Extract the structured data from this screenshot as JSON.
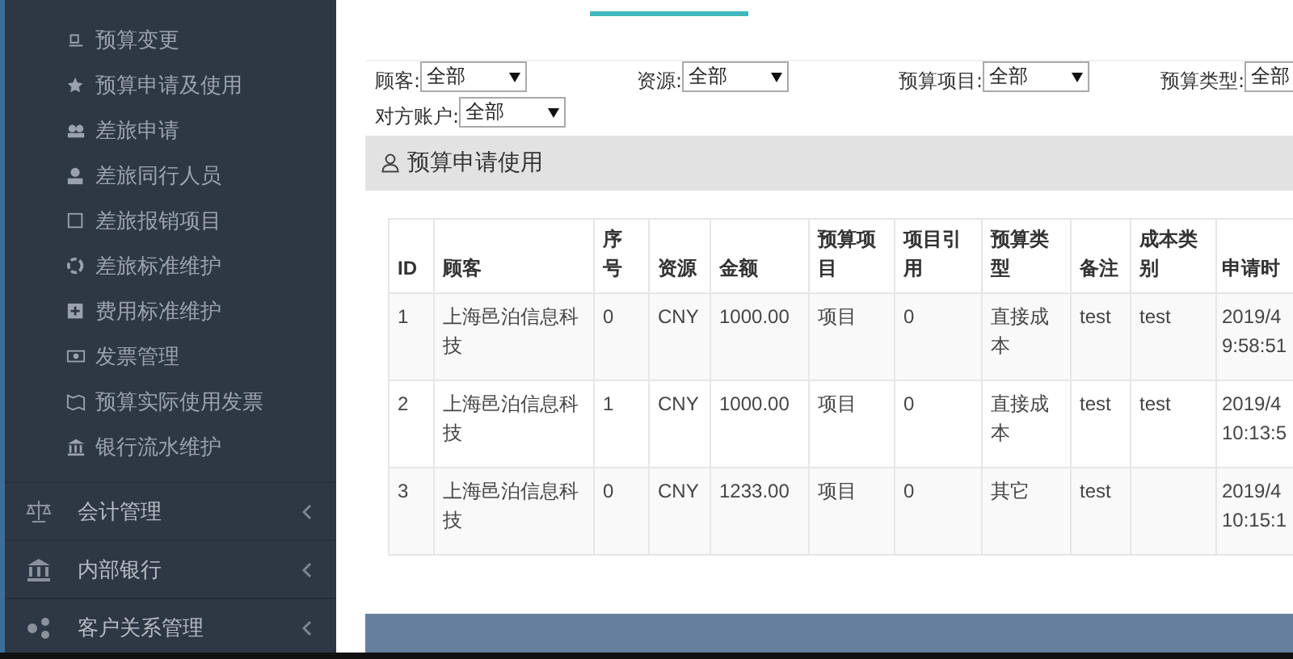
{
  "sidebar": {
    "sub_items": [
      {
        "label": "预算变更"
      },
      {
        "label": "预算申请及使用"
      },
      {
        "label": "差旅申请"
      },
      {
        "label": "差旅同行人员"
      },
      {
        "label": "差旅报销项目"
      },
      {
        "label": "差旅标准维护"
      },
      {
        "label": "费用标准维护"
      },
      {
        "label": "发票管理"
      },
      {
        "label": "预算实际使用发票"
      },
      {
        "label": "银行流水维护"
      }
    ],
    "sections": [
      {
        "label": "会计管理"
      },
      {
        "label": "内部银行"
      },
      {
        "label": "客户关系管理"
      }
    ]
  },
  "filters": [
    {
      "label": "顾客:",
      "value": "全部"
    },
    {
      "label": "资源:",
      "value": "全部"
    },
    {
      "label": "预算项目:",
      "value": "全部"
    },
    {
      "label": "预算类型:",
      "value": "全部"
    },
    {
      "label": "对方账户:",
      "value": "全部"
    }
  ],
  "panel": {
    "title": "预算申请使用",
    "table": {
      "columns": [
        "ID",
        "顾客",
        "序号",
        "资源",
        "金额",
        "预算项目",
        "项目引用",
        "预算类型",
        "备注",
        "成本类别",
        "申请时"
      ],
      "rows": [
        [
          "1",
          "上海邑泊信息科技",
          "0",
          "CNY",
          "1000.00",
          "项目",
          "0",
          "直接成本",
          "test",
          "test",
          "2019/4 9:58:51"
        ],
        [
          "2",
          "上海邑泊信息科技",
          "1",
          "CNY",
          "1000.00",
          "项目",
          "0",
          "直接成本",
          "test",
          "test",
          "2019/4 10:13:5"
        ],
        [
          "3",
          "上海邑泊信息科技",
          "0",
          "CNY",
          "1233.00",
          "项目",
          "0",
          "其它",
          "test",
          "",
          "2019/4 10:15:1"
        ]
      ]
    }
  }
}
